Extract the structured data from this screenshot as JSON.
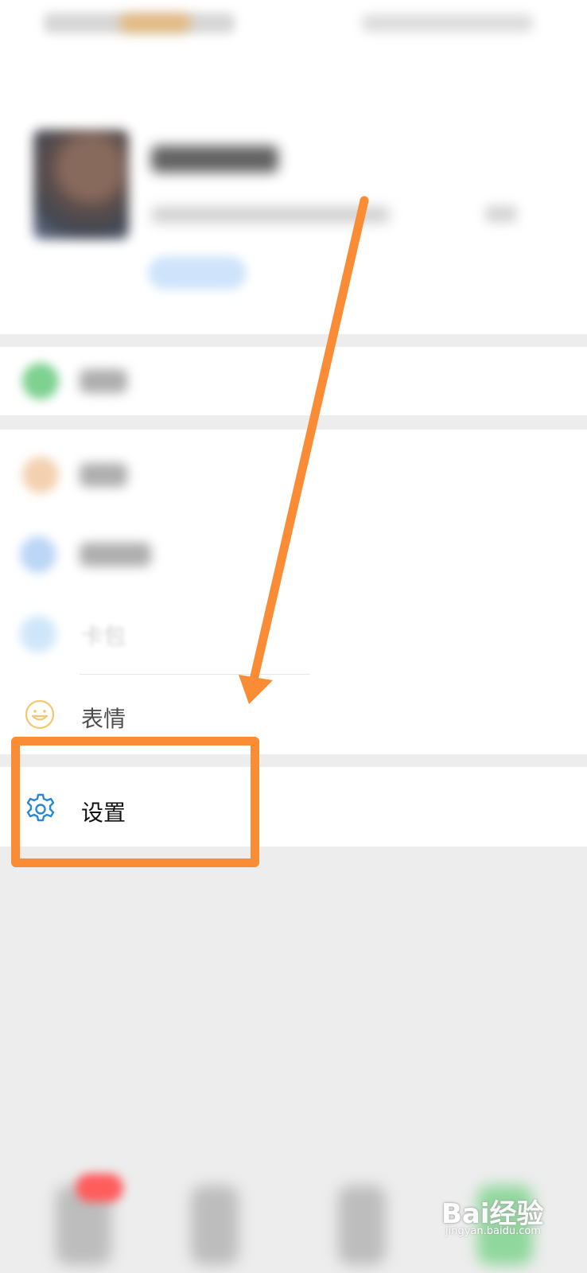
{
  "menu": {
    "emoji_label": "表情",
    "settings_label": "设置",
    "wallet_partial": "卡包"
  },
  "watermark": {
    "brand": "Bai经验",
    "url": "jingyan.baidu.com"
  },
  "colors": {
    "annotation_orange": "#fa8c35",
    "settings_icon_blue": "#2a86d6",
    "emoji_icon_yellow": "#f4c770"
  },
  "icons": [
    "emoji-icon",
    "gear-icon",
    "arrow-annotation"
  ]
}
